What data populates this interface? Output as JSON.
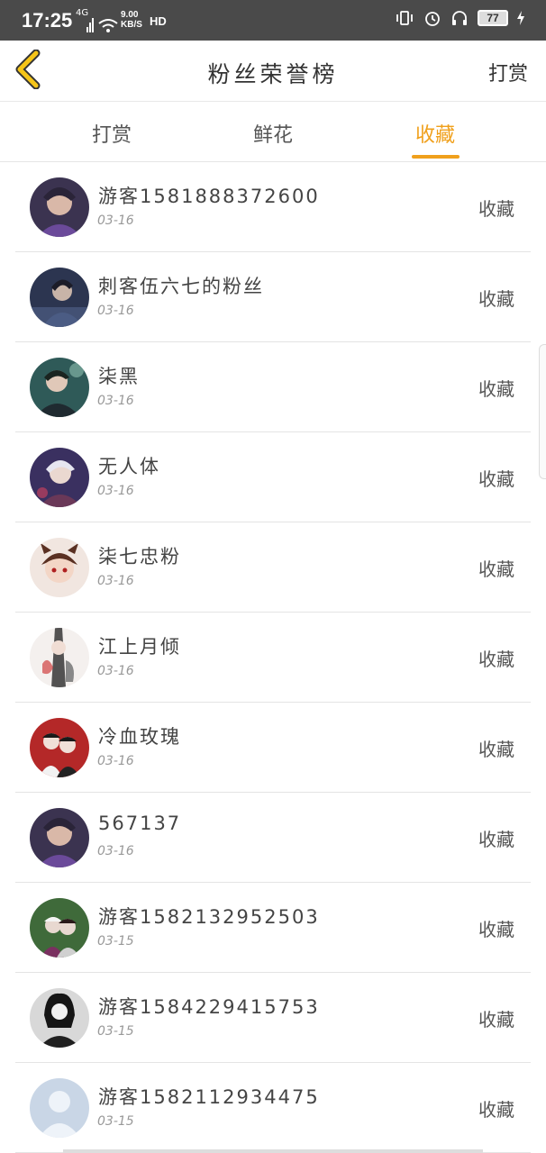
{
  "status": {
    "time": "17:25",
    "network": "4G",
    "speed_value": "9.00",
    "speed_unit": "KB/S",
    "hd": "HD",
    "battery": "77"
  },
  "header": {
    "title": "粉丝荣誉榜",
    "right_label": "打赏"
  },
  "tabs": [
    {
      "label": "打赏",
      "active": false
    },
    {
      "label": "鲜花",
      "active": false
    },
    {
      "label": "收藏",
      "active": true
    }
  ],
  "colors": {
    "accent": "#f0a01c",
    "status_bar": "#4a4a4a"
  },
  "list": [
    {
      "name": "游客1581888372600",
      "date": "03-16",
      "action": "收藏"
    },
    {
      "name": "刺客伍六七的粉丝",
      "date": "03-16",
      "action": "收藏"
    },
    {
      "name": "柒黑",
      "date": "03-16",
      "action": "收藏"
    },
    {
      "name": "无人体",
      "date": "03-16",
      "action": "收藏"
    },
    {
      "name": "柒七忠粉",
      "date": "03-16",
      "action": "收藏"
    },
    {
      "name": "江上月倾",
      "date": "03-16",
      "action": "收藏"
    },
    {
      "name": "冷血玫瑰",
      "date": "03-16",
      "action": "收藏"
    },
    {
      "name": "567137",
      "date": "03-16",
      "action": "收藏"
    },
    {
      "name": "游客1582132952503",
      "date": "03-15",
      "action": "收藏"
    },
    {
      "name": "游客1584229415753",
      "date": "03-15",
      "action": "收藏"
    },
    {
      "name": "游客1582112934475",
      "date": "03-15",
      "action": "收藏"
    }
  ]
}
